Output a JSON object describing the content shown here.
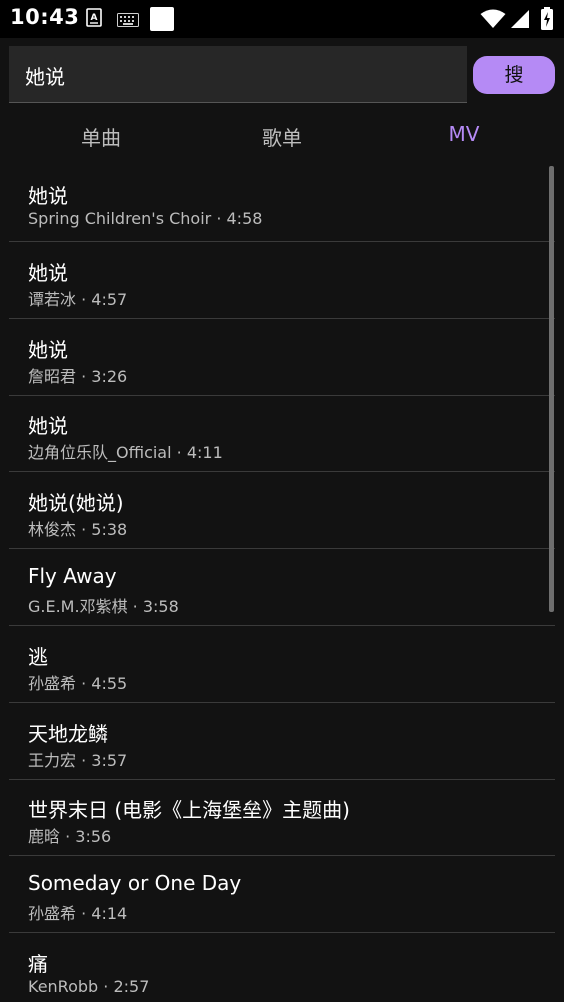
{
  "status_bar": {
    "time": "10:43",
    "icons": [
      "a-keyboard-icon",
      "keyboard-icon",
      "square-icon",
      "wifi-icon",
      "signal-icon",
      "battery-charging-icon"
    ]
  },
  "search": {
    "value": "她说",
    "button_label": "搜"
  },
  "tabs": [
    {
      "label": "单曲",
      "active": false
    },
    {
      "label": "歌单",
      "active": false
    },
    {
      "label": "MV",
      "active": true
    }
  ],
  "results": [
    {
      "title": "她说",
      "subtitle": "Spring Children's Choir · 4:58"
    },
    {
      "title": "她说",
      "subtitle": "谭若冰 · 4:57"
    },
    {
      "title": "她说",
      "subtitle": "詹昭君 · 3:26"
    },
    {
      "title": "她说",
      "subtitle": "边角位乐队_Official · 4:11"
    },
    {
      "title": "她说(她说)",
      "subtitle": "林俊杰 · 5:38"
    },
    {
      "title": "Fly Away",
      "subtitle": "G.E.M.邓紫棋 · 3:58"
    },
    {
      "title": "逃",
      "subtitle": "孙盛希 · 4:55"
    },
    {
      "title": "天地龙鳞",
      "subtitle": "王力宏 · 3:57"
    },
    {
      "title": "世界末日 (电影《上海堡垒》主题曲)",
      "subtitle": "鹿晗 · 3:56"
    },
    {
      "title": "Someday or One Day",
      "subtitle": "孙盛希 · 4:14"
    },
    {
      "title": "痛",
      "subtitle": "KenRobb · 2:57"
    }
  ],
  "colors": {
    "accent": "#b58af5",
    "background": "#121212",
    "search_bg": "#272727",
    "divider": "#3a3a3a"
  }
}
